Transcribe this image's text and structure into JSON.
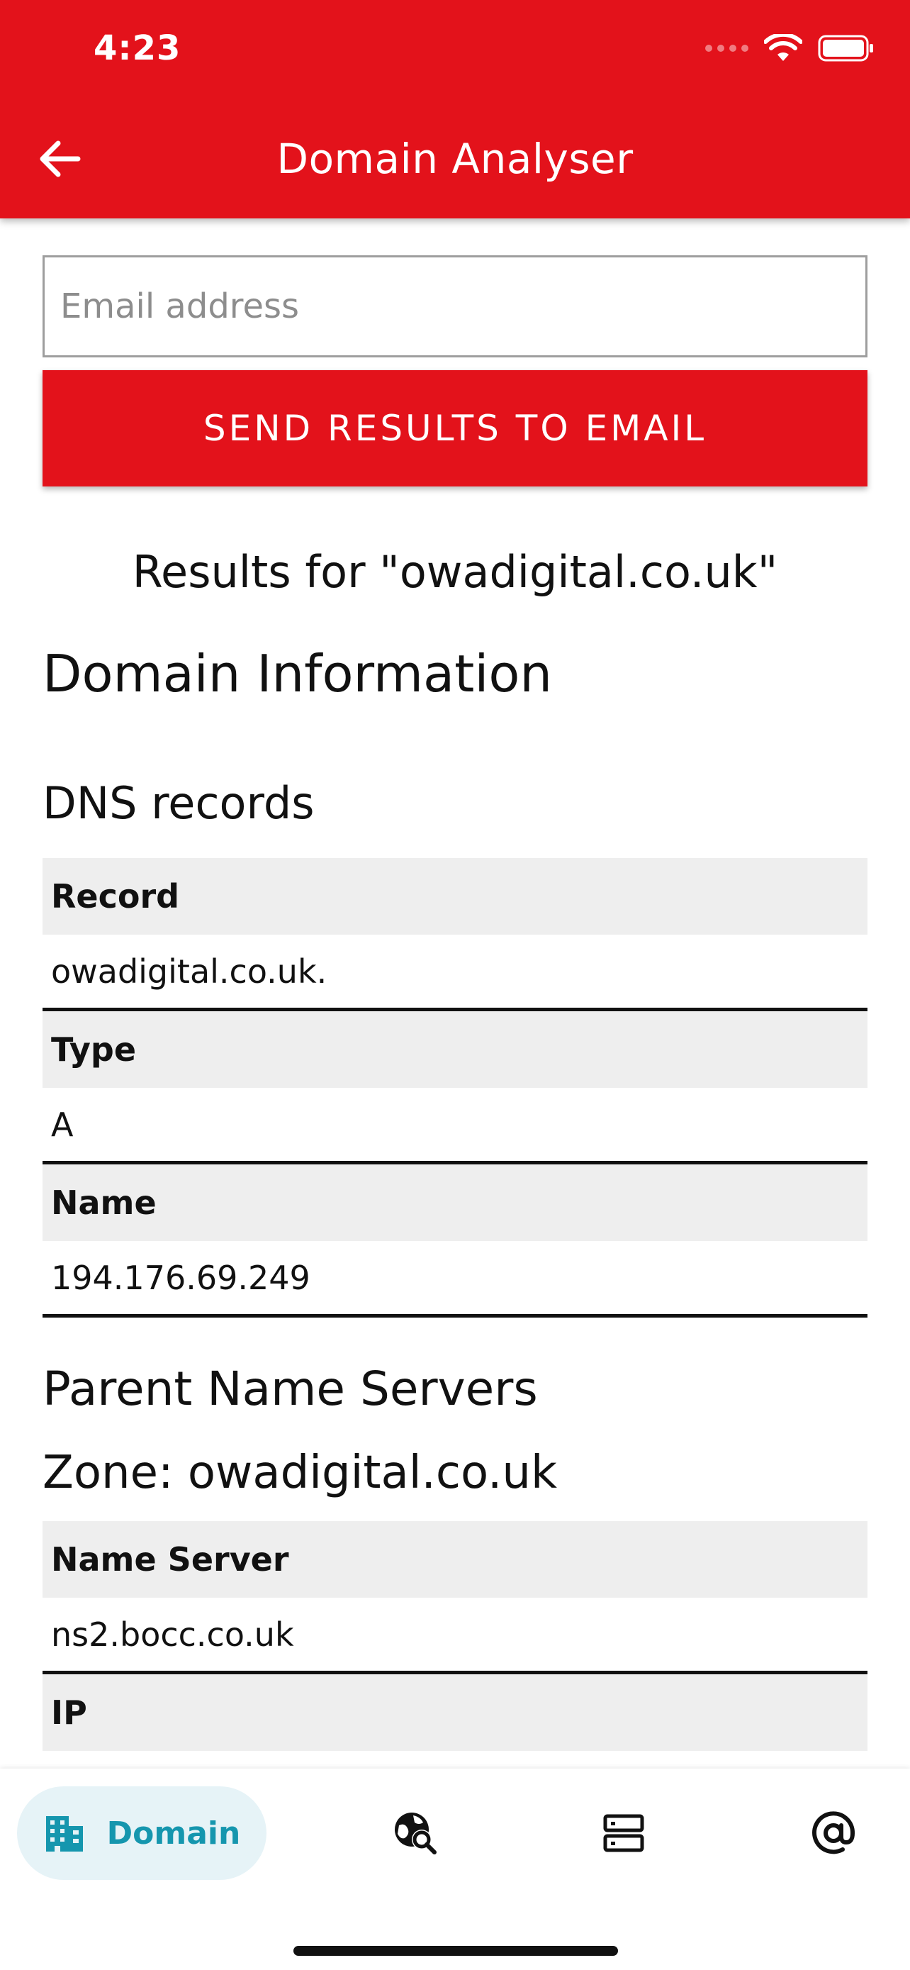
{
  "status_bar": {
    "time": "4:23"
  },
  "app_bar": {
    "title": "Domain Analyser",
    "back_icon": "arrow-left-icon"
  },
  "email_form": {
    "email_placeholder": "Email address",
    "email_value": "",
    "send_label": "SEND RESULTS TO EMAIL"
  },
  "results": {
    "heading": "Results for \"owadigital.co.uk\"",
    "domain_info_title": "Domain Information",
    "dns": {
      "title": "DNS records",
      "rows": [
        {
          "label": "Record",
          "value": "owadigital.co.uk."
        },
        {
          "label": "Type",
          "value": "A"
        },
        {
          "label": "Name",
          "value": "194.176.69.249"
        }
      ]
    },
    "parent_ns": {
      "title": "Parent Name Servers",
      "zone": "Zone: owadigital.co.uk",
      "rows": [
        {
          "label": "Name Server",
          "value": "ns2.bocc.co.uk"
        },
        {
          "label": "IP",
          "value": ""
        }
      ]
    }
  },
  "bottom_nav": {
    "items": [
      {
        "label": "Domain",
        "icon": "building-icon",
        "active": true
      },
      {
        "label": "",
        "icon": "globe-search-icon",
        "active": false
      },
      {
        "label": "",
        "icon": "dns-server-icon",
        "active": false
      },
      {
        "label": "",
        "icon": "at-sign-icon",
        "active": false
      }
    ]
  },
  "colors": {
    "primary": "#e3121b",
    "active_nav_bg": "#e6f3f7",
    "active_nav_fg": "#1596ae",
    "label_row_bg": "#eeeeee"
  }
}
